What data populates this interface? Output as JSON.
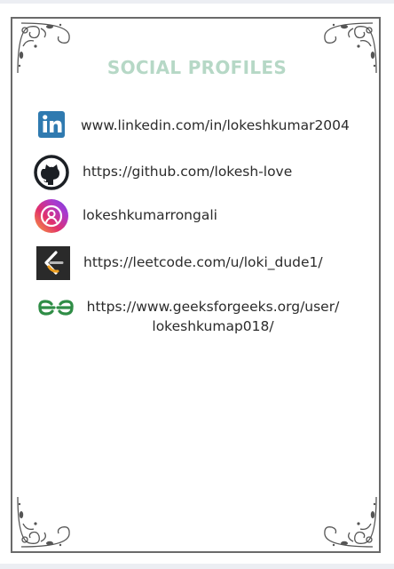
{
  "title": "SOCIAL PROFILES",
  "profiles": [
    {
      "icon": "linkedin-icon",
      "label": "www.linkedin.com/in/lokeshkumar2004"
    },
    {
      "icon": "github-icon",
      "label": "https://github.com/lokesh-love"
    },
    {
      "icon": "instagram-icon",
      "label": "lokeshkumarrongali"
    },
    {
      "icon": "leetcode-icon",
      "label": "https://leetcode.com/u/loki_dude1/"
    },
    {
      "icon": "geeksforgeeks-icon",
      "label": "https://www.geeksforgeeks.org/user/ lokeshkumap018/"
    }
  ],
  "colors": {
    "title": "#b6d8c6",
    "frame": "#6a6a6a",
    "linkedin": "#2f7ab0",
    "github": "#1b1f24",
    "gfg": "#2f8d46",
    "leetcode_bg": "#2a2a2a",
    "leetcode_accent": "#f0a020"
  }
}
